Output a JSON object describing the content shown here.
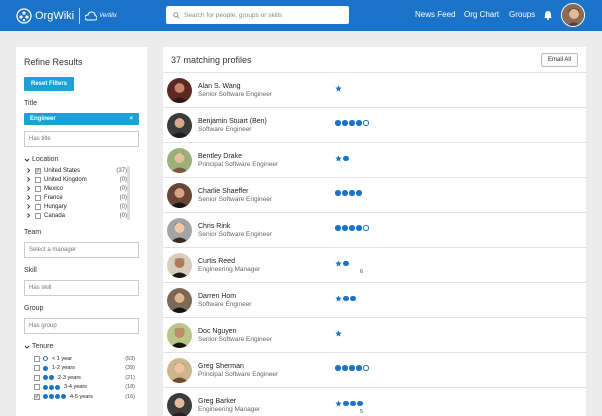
{
  "header": {
    "brand": "OrgWiki",
    "brand_sub": "Vertilix",
    "search_placeholder": "Search for people, groups or skills",
    "nav": [
      "News Feed",
      "Org Chart",
      "Groups"
    ]
  },
  "sidebar": {
    "title": "Refine Results",
    "reset_label": "Reset Filters",
    "title_label": "Title",
    "title_chip": "Engineer",
    "title_chip_close": "×",
    "title_placeholder": "Has title",
    "location_label": "Location",
    "locations": [
      {
        "name": "United States",
        "count": "(37)",
        "checked": true
      },
      {
        "name": "United Kingdom",
        "count": "(0)",
        "checked": false
      },
      {
        "name": "Mexico",
        "count": "(0)",
        "checked": false
      },
      {
        "name": "France",
        "count": "(0)",
        "checked": false
      },
      {
        "name": "Hungary",
        "count": "(0)",
        "checked": false
      },
      {
        "name": "Canada",
        "count": "(0)",
        "checked": false
      }
    ],
    "team_label": "Team",
    "team_placeholder": "Select a manager",
    "skill_label": "Skill",
    "skill_placeholder": "Has skill",
    "group_label": "Group",
    "group_placeholder": "Has group",
    "tenure_label": "Tenure",
    "tenure": [
      {
        "label": "< 1 year",
        "count": "(53)",
        "filled": 0,
        "outline": 1,
        "checked": false
      },
      {
        "label": "1-2 years",
        "count": "(39)",
        "filled": 1,
        "outline": 0,
        "checked": false
      },
      {
        "label": "2-3 years",
        "count": "(21)",
        "filled": 2,
        "outline": 0,
        "checked": false
      },
      {
        "label": "3-4 years",
        "count": "(18)",
        "filled": 3,
        "outline": 0,
        "checked": false
      },
      {
        "label": "4-5 years",
        "count": "(16)",
        "filled": 4,
        "outline": 0,
        "checked": true
      }
    ]
  },
  "main": {
    "title": "37 matching profiles",
    "email_label": "Email All",
    "profiles": [
      {
        "name": "Alan S. Wang",
        "title": "Senior Software Engineer",
        "stars": 1,
        "filled": 0,
        "outline": 0,
        "sub": ""
      },
      {
        "name": "Benjamin Stuart (Ben)",
        "title": "Software Engineer",
        "stars": 0,
        "filled": 4,
        "outline": 1,
        "sub": ""
      },
      {
        "name": "Bentley Drake",
        "title": "Principal Software Engineer",
        "stars": 1,
        "filled": 1,
        "outline": 0,
        "sub": ""
      },
      {
        "name": "Charlie Shaeffer",
        "title": "Senior Software Engineer",
        "stars": 0,
        "filled": 4,
        "outline": 0,
        "sub": ""
      },
      {
        "name": "Chris Rink",
        "title": "Senior Software Engineer",
        "stars": 0,
        "filled": 4,
        "outline": 1,
        "sub": ""
      },
      {
        "name": "Curtis Reed",
        "title": "Engineering Manager",
        "stars": 1,
        "filled": 1,
        "outline": 0,
        "sub": "6"
      },
      {
        "name": "Darren Hom",
        "title": "Software Engineer",
        "stars": 1,
        "filled": 2,
        "outline": 0,
        "sub": ""
      },
      {
        "name": "Doc Nguyen",
        "title": "Senior Software Engineer",
        "stars": 1,
        "filled": 0,
        "outline": 0,
        "sub": ""
      },
      {
        "name": "Greg Sherman",
        "title": "Principal Software Engineer",
        "stars": 0,
        "filled": 4,
        "outline": 1,
        "sub": ""
      },
      {
        "name": "Greg Barker",
        "title": "Engineering Manager",
        "stars": 1,
        "filled": 3,
        "outline": 0,
        "sub": "5"
      }
    ]
  },
  "colors": {
    "brand": "#1a73c6",
    "accent": "#1ea0d6"
  }
}
